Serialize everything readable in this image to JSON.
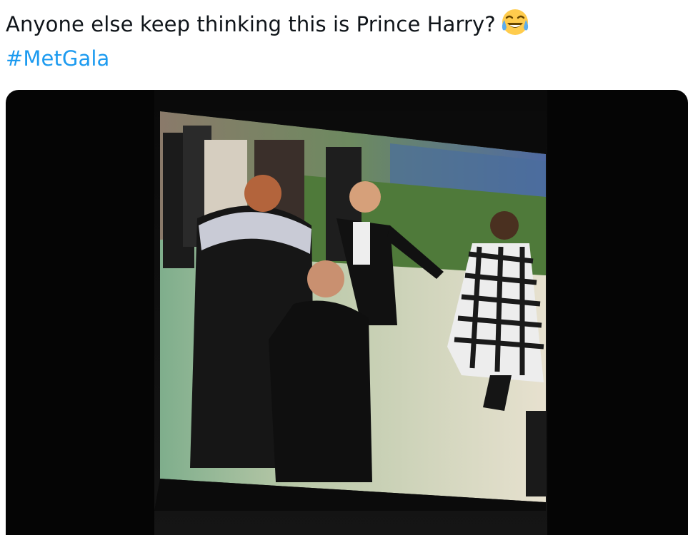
{
  "tweet": {
    "text_main": "Anyone else keep thinking this is Prince Harry?",
    "emoji": "face-with-tears-of-joy-icon",
    "hashtag": "#MetGala"
  },
  "colors": {
    "text": "#0f1419",
    "link": "#1d9bf0",
    "media_bg": "#050505"
  }
}
